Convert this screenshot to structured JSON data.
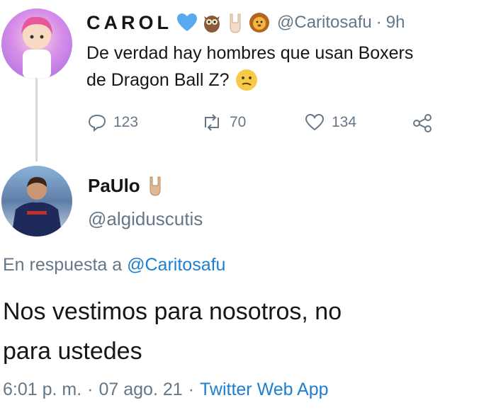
{
  "original_tweet": {
    "display_name": "CAROL",
    "handle": "@Caritosafu",
    "time": "9h",
    "text_line1": "De verdad hay hombres que usan Boxers",
    "text_line2": "de Dragon Ball Z?",
    "actions": {
      "replies": "123",
      "retweets": "70",
      "likes": "134"
    }
  },
  "reply_tweet": {
    "display_name": "PaUlo",
    "handle": "@algiduscutis",
    "reply_prefix": "En respuesta a",
    "reply_target": "@Caritosafu",
    "text_line1": "Nos vestimos para nosotros, no",
    "text_line2": "para ustedes",
    "time": "6:01 p. m.",
    "date": "07 ago. 21",
    "source": "Twitter Web App"
  },
  "colors": {
    "accent": "#1d7fd1",
    "muted": "#657786",
    "heart_blue": "#5aa9f0"
  }
}
